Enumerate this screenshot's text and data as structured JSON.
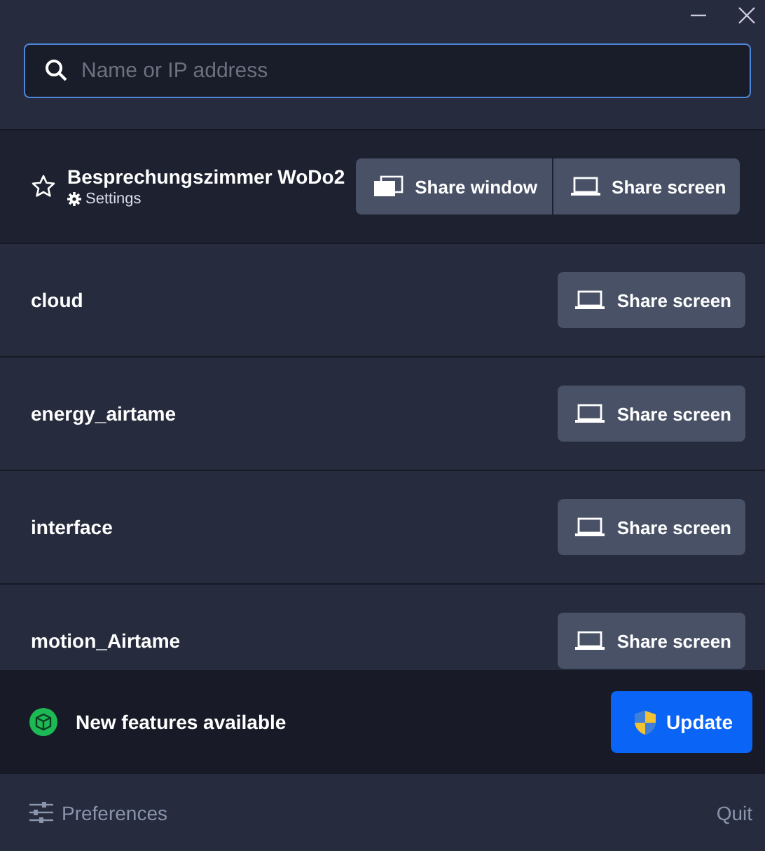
{
  "window": {
    "controls": [
      {
        "kind": "minimize"
      },
      {
        "kind": "close"
      }
    ]
  },
  "search": {
    "placeholder": "Name or IP address"
  },
  "devices": [
    {
      "name": "Besprechungszimmer WoDo2",
      "selected": true,
      "favorite": false,
      "settings": "Settings",
      "buttons": [
        {
          "kind": "window",
          "label": "Share window"
        },
        {
          "kind": "screen",
          "label": "Share screen"
        }
      ]
    },
    {
      "name": "cloud",
      "selected": false,
      "buttons": [
        {
          "kind": "screen",
          "label": "Share screen"
        }
      ]
    },
    {
      "name": "energy_airtame",
      "selected": false,
      "buttons": [
        {
          "kind": "screen",
          "label": "Share screen"
        }
      ]
    },
    {
      "name": "interface",
      "selected": false,
      "buttons": [
        {
          "kind": "screen",
          "label": "Share screen"
        }
      ]
    },
    {
      "name": "motion_Airtame",
      "selected": false,
      "buttons": [
        {
          "kind": "screen",
          "label": "Share screen"
        }
      ]
    }
  ],
  "banner": {
    "text": "New features available",
    "button": "Update"
  },
  "footer": {
    "preferences": "Preferences",
    "quit": "Quit"
  }
}
